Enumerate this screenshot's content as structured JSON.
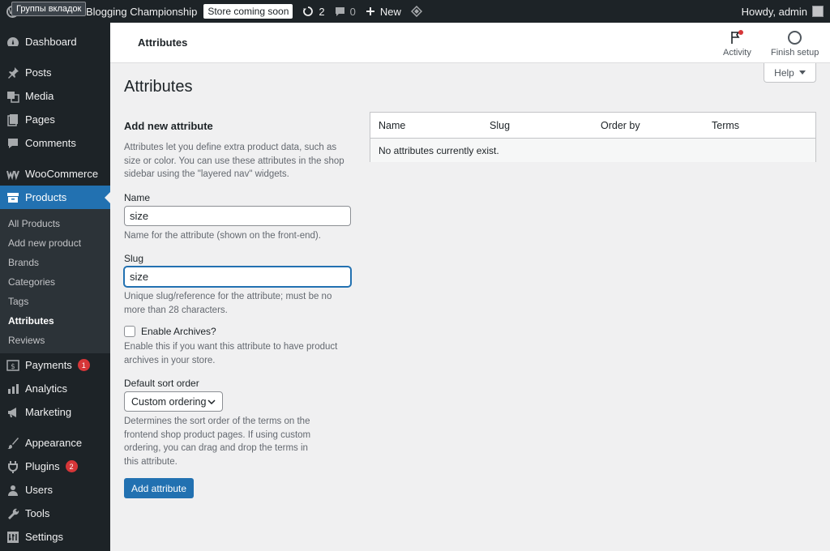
{
  "adminbar": {
    "tooltip": "Группы вкладок",
    "site_name": "Blogging Championship",
    "store_badge": "Store coming soon",
    "updates_count": "2",
    "comments_count": "0",
    "new_label": "New",
    "greeting": "Howdy, admin"
  },
  "sidebar": {
    "items": [
      {
        "label": "Dashboard",
        "icon": "dashboard-icon"
      },
      {
        "label": "Posts",
        "icon": "pin-icon"
      },
      {
        "label": "Media",
        "icon": "media-icon"
      },
      {
        "label": "Pages",
        "icon": "pages-icon"
      },
      {
        "label": "Comments",
        "icon": "comment-icon"
      },
      {
        "label": "WooCommerce",
        "icon": "woo-icon"
      },
      {
        "label": "Products",
        "icon": "archive-icon"
      }
    ],
    "submenu": [
      "All Products",
      "Add new product",
      "Brands",
      "Categories",
      "Tags",
      "Attributes",
      "Reviews"
    ],
    "items_after": [
      {
        "label": "Payments",
        "badge": "1",
        "icon": "payments-icon"
      },
      {
        "label": "Analytics",
        "icon": "analytics-icon"
      },
      {
        "label": "Marketing",
        "icon": "megaphone-icon"
      },
      {
        "label": "Appearance",
        "icon": "brush-icon"
      },
      {
        "label": "Plugins",
        "badge": "2",
        "icon": "plugin-icon"
      },
      {
        "label": "Users",
        "icon": "user-icon"
      },
      {
        "label": "Tools",
        "icon": "wrench-icon"
      },
      {
        "label": "Settings",
        "icon": "settings-icon"
      }
    ]
  },
  "header": {
    "title": "Attributes",
    "activity": "Activity",
    "finish_setup": "Finish setup"
  },
  "help_label": "Help",
  "page_title": "Attributes",
  "form": {
    "heading": "Add new attribute",
    "intro": "Attributes let you define extra product data, such as size or color. You can use these attributes in the shop sidebar using the \"layered nav\" widgets.",
    "name_label": "Name",
    "name_value": "size",
    "name_desc": "Name for the attribute (shown on the front-end).",
    "slug_label": "Slug",
    "slug_value": "size",
    "slug_desc": "Unique slug/reference for the attribute; must be no more than 28 characters.",
    "archives_label": "Enable Archives?",
    "archives_desc": "Enable this if you want this attribute to have product archives in your store.",
    "sort_label": "Default sort order",
    "sort_value": "Custom ordering",
    "sort_desc": "Determines the sort order of the terms on the frontend shop product pages. If using custom ordering, you can drag and drop the terms in this attribute.",
    "submit": "Add attribute"
  },
  "table": {
    "columns": [
      "Name",
      "Slug",
      "Order by",
      "Terms"
    ],
    "empty": "No attributes currently exist."
  },
  "colors": {
    "accent": "#2271b1",
    "sidebar_bg": "#1d2327",
    "badge": "#d63638"
  }
}
